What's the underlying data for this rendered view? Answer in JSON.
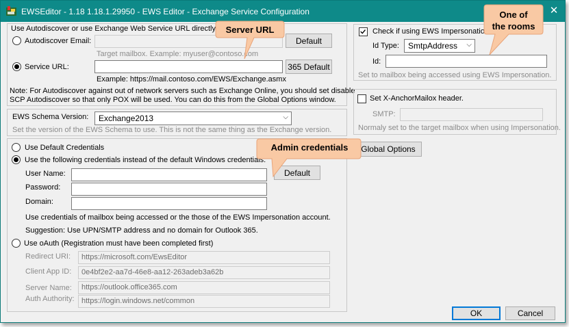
{
  "window": {
    "title": "EWSEditor - 1.18 1.18.1.29950 - EWS Editor - Exchange Service Configuration",
    "close_glyph": "✕",
    "icon": "ewseditor-app-icon"
  },
  "autodiscover_group": {
    "heading": "Use Autodiscover or use Exchange Web Service URL directly:",
    "autodiscover_label": "Autodiscover Email:",
    "autodiscover_value": "",
    "default_button": "Default",
    "target_hint": "Target mailbox.  Example: myuser@contoso.com",
    "service_url_label": "Service URL:",
    "service_url_value": "",
    "default365_button": "365 Default",
    "example_text": "Example: https://mail.contoso.com/EWS/Exchange.asmx",
    "note_line1": "Note: For Autodiscover against out of network servers such as Exchange Online, you should set disable",
    "note_line2": "SCP Autodiscover so that only POX will be used.  You can do this from the Global Options window."
  },
  "schema_group": {
    "label": "EWS Schema Version:",
    "selected": "Exchange2013",
    "hint": "Set the version of the EWS Schema to use.  This is not the same thing as the Exchange version."
  },
  "credentials_group": {
    "default_creds": "Use Default Credentials",
    "following_creds": "Use the following credentials instead of the default Windows credentials.",
    "username_label": "User Name:",
    "password_label": "Password:",
    "domain_label": "Domain:",
    "default_button": "Default",
    "hint1": "Use credentials of mailbox being accessed or the those of the EWS Impersonation account.",
    "hint2": "Suggestion: Use UPN/SMTP address and no domain for Outlook 365.",
    "oauth_label": "Use oAuth (Registration must have been completed first)",
    "redirect_label": "Redirect URI:",
    "redirect_value": "https://microsoft.com/EwsEditor",
    "client_id_label": "Client App ID:",
    "client_id_value": "0e4bf2e2-aa7d-46e8-aa12-263adeb3a62b",
    "server_label": "Server Name:",
    "server_value": "https://outlook.office365.com",
    "authority_label": "Auth Authority:",
    "authority_value": "https://login.windows.net/common"
  },
  "impersonation_group": {
    "check_label": "Check if using EWS Impersonation.",
    "idtype_label": "Id Type:",
    "idtype_selected": "SmtpAddress",
    "id_label": "Id:",
    "id_value": "",
    "hint": "Set to mailbox being accessed using EWS Impersonation."
  },
  "anchor_group": {
    "check_label": "Set X-AnchorMailox header.",
    "smtp_label": "SMTP:",
    "smtp_value": "",
    "hint": "Normaly set to the target mailbox when using Impersonation."
  },
  "global_options_button": "Global Options",
  "ok_button": "OK",
  "cancel_button": "Cancel",
  "callouts": {
    "server_url": "Server URL",
    "admin_credentials": "Admin credentials",
    "rooms_line1": "One of",
    "rooms_line2": "the rooms"
  },
  "colors": {
    "titlebar": "#0e8a89",
    "callout_fill": "#f9c9a4",
    "callout_stroke": "#e8a47a"
  }
}
